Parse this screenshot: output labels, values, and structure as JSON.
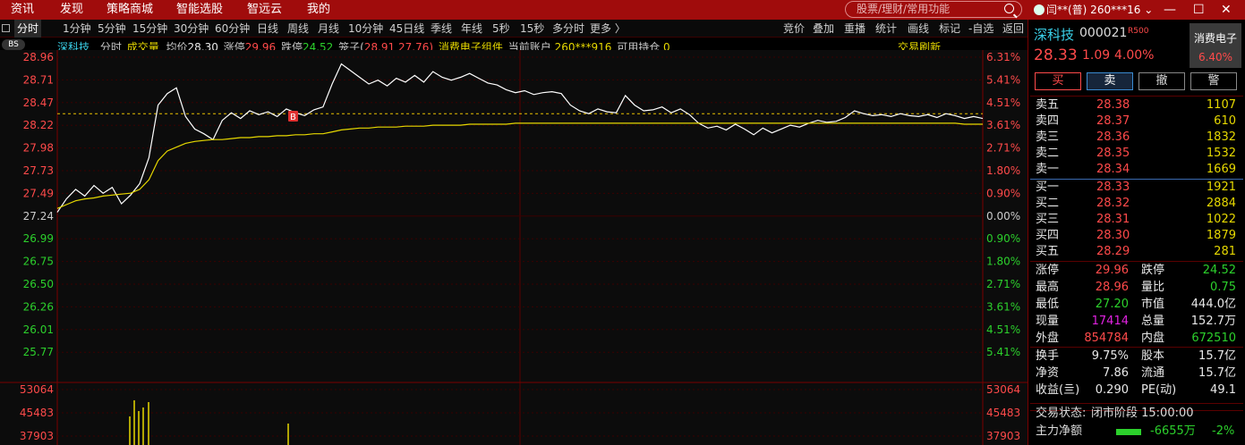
{
  "topmenu": [
    "资讯",
    "发现",
    "策略商城",
    "智能选股",
    "智远云",
    "我的"
  ],
  "search_placeholder": "股票/理财/常用功能",
  "user_label": "闫**(普) 260***16",
  "user_dropdown": "⌄",
  "window_controls": [
    "—",
    "☐",
    "✕"
  ],
  "periods": [
    "分时",
    "1分钟",
    "5分钟",
    "15分钟",
    "30分钟",
    "60分钟",
    "日线",
    "周线",
    "月线",
    "10分钟",
    "45日线",
    "季线",
    "年线",
    "5秒",
    "15秒",
    "多分时",
    "更多 〉"
  ],
  "tools": [
    "竞价",
    "叠加",
    "重播",
    "统计",
    "画线",
    "标记",
    "-自选",
    "返回"
  ],
  "bs_label": "BS",
  "info": {
    "name": "深科技",
    "mode": "分时",
    "vol": "成交量",
    "avg_label": "均价",
    "avg": "28.30",
    "zt_label": "涨停",
    "zt": "29.96",
    "dt_label": "跌停",
    "dt": "24.52",
    "cage_label": "笼子(",
    "cage_hi": "28.91",
    "cage_lo": " 27.76)",
    "sector": "消费电子组件",
    "acct_label": "当前账户",
    "acct": "260***916",
    "hold_label": "可用持仓",
    "hold": "0"
  },
  "refresh_label": "交易刷新",
  "chart_data": {
    "type": "line",
    "title": "深科技 分时",
    "y_left_ticks": [
      "28.96",
      "28.71",
      "28.47",
      "28.22",
      "27.98",
      "27.73",
      "27.49",
      "27.24",
      "26.99",
      "26.75",
      "26.50",
      "26.26",
      "26.01",
      "25.77"
    ],
    "y_right_ticks": [
      "6.31%",
      "5.41%",
      "4.51%",
      "3.61%",
      "2.71%",
      "1.80%",
      "0.90%",
      "0.00%",
      "0.90%",
      "1.80%",
      "2.71%",
      "3.61%",
      "4.51%",
      "5.41%"
    ],
    "vol_ticks": [
      "53064",
      "45483",
      "37903"
    ],
    "prev_close": 27.24,
    "ylim": [
      25.65,
      29.0
    ],
    "series": [
      {
        "name": "价格",
        "color": "#ffffff",
        "values": [
          27.38,
          27.52,
          27.62,
          27.55,
          27.66,
          27.58,
          27.64,
          27.47,
          27.56,
          27.68,
          27.95,
          28.5,
          28.62,
          28.68,
          28.38,
          28.25,
          28.2,
          28.14,
          28.34,
          28.42,
          28.36,
          28.44,
          28.4,
          28.43,
          28.38,
          28.46,
          28.42,
          28.39,
          28.45,
          28.48,
          28.72,
          28.93,
          28.86,
          28.79,
          28.72,
          28.76,
          28.7,
          28.78,
          28.74,
          28.81,
          28.74,
          28.85,
          28.79,
          28.76,
          28.79,
          28.83,
          28.78,
          28.73,
          28.71,
          28.66,
          28.63,
          28.65,
          28.61,
          28.63,
          28.64,
          28.62,
          28.5,
          28.44,
          28.41,
          28.46,
          28.43,
          28.42,
          28.6,
          28.5,
          28.44,
          28.45,
          28.48,
          28.42,
          28.46,
          28.4,
          28.31,
          28.26,
          28.28,
          28.24,
          28.3,
          28.25,
          28.19,
          28.26,
          28.21,
          28.25,
          28.29,
          28.27,
          28.31,
          28.34,
          28.32,
          28.33,
          28.37,
          28.44,
          28.41,
          28.39,
          28.4,
          28.38,
          28.41,
          28.39,
          28.38,
          28.4,
          28.37,
          28.41,
          28.39,
          28.36,
          28.38,
          28.36
        ]
      },
      {
        "name": "均价",
        "color": "#e6d800",
        "values": [
          27.42,
          27.46,
          27.5,
          27.52,
          27.53,
          27.55,
          27.56,
          27.57,
          27.58,
          27.62,
          27.72,
          27.92,
          28.02,
          28.06,
          28.1,
          28.12,
          28.13,
          28.14,
          28.14,
          28.15,
          28.16,
          28.16,
          28.17,
          28.17,
          28.18,
          28.18,
          28.19,
          28.19,
          28.2,
          28.2,
          28.22,
          28.24,
          28.25,
          28.26,
          28.26,
          28.27,
          28.27,
          28.27,
          28.28,
          28.28,
          28.28,
          28.29,
          28.29,
          28.29,
          28.29,
          28.3,
          28.3,
          28.3,
          28.3,
          28.3,
          28.31,
          28.31,
          28.31,
          28.31,
          28.31,
          28.31,
          28.31,
          28.31,
          28.31,
          28.31,
          28.31,
          28.31,
          28.31,
          28.31,
          28.31,
          28.31,
          28.31,
          28.31,
          28.31,
          28.31,
          28.31,
          28.31,
          28.31,
          28.31,
          28.31,
          28.31,
          28.31,
          28.31,
          28.31,
          28.31,
          28.31,
          28.31,
          28.31,
          28.31,
          28.31,
          28.31,
          28.31,
          28.31,
          28.31,
          28.31,
          28.31,
          28.31,
          28.31,
          28.31,
          28.31,
          28.31,
          28.31,
          28.31,
          28.31,
          28.3,
          28.3,
          28.3
        ]
      }
    ],
    "marker": "B"
  },
  "panel": {
    "name": "深科技",
    "code": "000021",
    "tag": "R500",
    "sector": "消费电子",
    "sector_pct": "6.40%",
    "price": "28.33",
    "chg": "1.09",
    "pct": "4.00%",
    "buttons": [
      "买",
      "卖",
      "撤",
      "警"
    ],
    "asks": [
      {
        "l": "卖五",
        "p": "28.38",
        "v": "1107"
      },
      {
        "l": "卖四",
        "p": "28.37",
        "v": "610"
      },
      {
        "l": "卖三",
        "p": "28.36",
        "v": "1832"
      },
      {
        "l": "卖二",
        "p": "28.35",
        "v": "1532"
      },
      {
        "l": "卖一",
        "p": "28.34",
        "v": "1669"
      }
    ],
    "bids": [
      {
        "l": "买一",
        "p": "28.33",
        "v": "1921"
      },
      {
        "l": "买二",
        "p": "28.32",
        "v": "2884"
      },
      {
        "l": "买三",
        "p": "28.31",
        "v": "1022"
      },
      {
        "l": "买四",
        "p": "28.30",
        "v": "1879"
      },
      {
        "l": "买五",
        "p": "28.29",
        "v": "281"
      }
    ],
    "stats": [
      {
        "a": "涨停",
        "av": "29.96",
        "ac": "red",
        "b": "跌停",
        "bv": "24.52",
        "bc": "green"
      },
      {
        "a": "最高",
        "av": "28.96",
        "ac": "red",
        "b": "量比",
        "bv": "0.75",
        "bc": "green"
      },
      {
        "a": "最低",
        "av": "27.20",
        "ac": "green",
        "b": "市值",
        "bv": "444.0亿",
        "bc": "white"
      },
      {
        "a": "现量",
        "av": "17414",
        "ac": "mag",
        "b": "总量",
        "bv": "152.7万",
        "bc": "white"
      },
      {
        "a": "外盘",
        "av": "854784",
        "ac": "red",
        "b": "内盘",
        "bv": "672510",
        "bc": "green"
      }
    ],
    "stats2": [
      {
        "a": "换手",
        "av": "9.75%",
        "b": "股本",
        "bv": "15.7亿"
      },
      {
        "a": "净资",
        "av": "7.86",
        "b": "流通",
        "bv": "15.7亿"
      },
      {
        "a": "收益(亖)",
        "av": "0.290",
        "b": "PE(动)",
        "bv": "49.1"
      }
    ],
    "status_label": "交易状态:",
    "status": "闭市阶段 15:00:00",
    "flow_label": "主力净额",
    "flow_val": "-6655万",
    "flow_pct": "-2%"
  }
}
